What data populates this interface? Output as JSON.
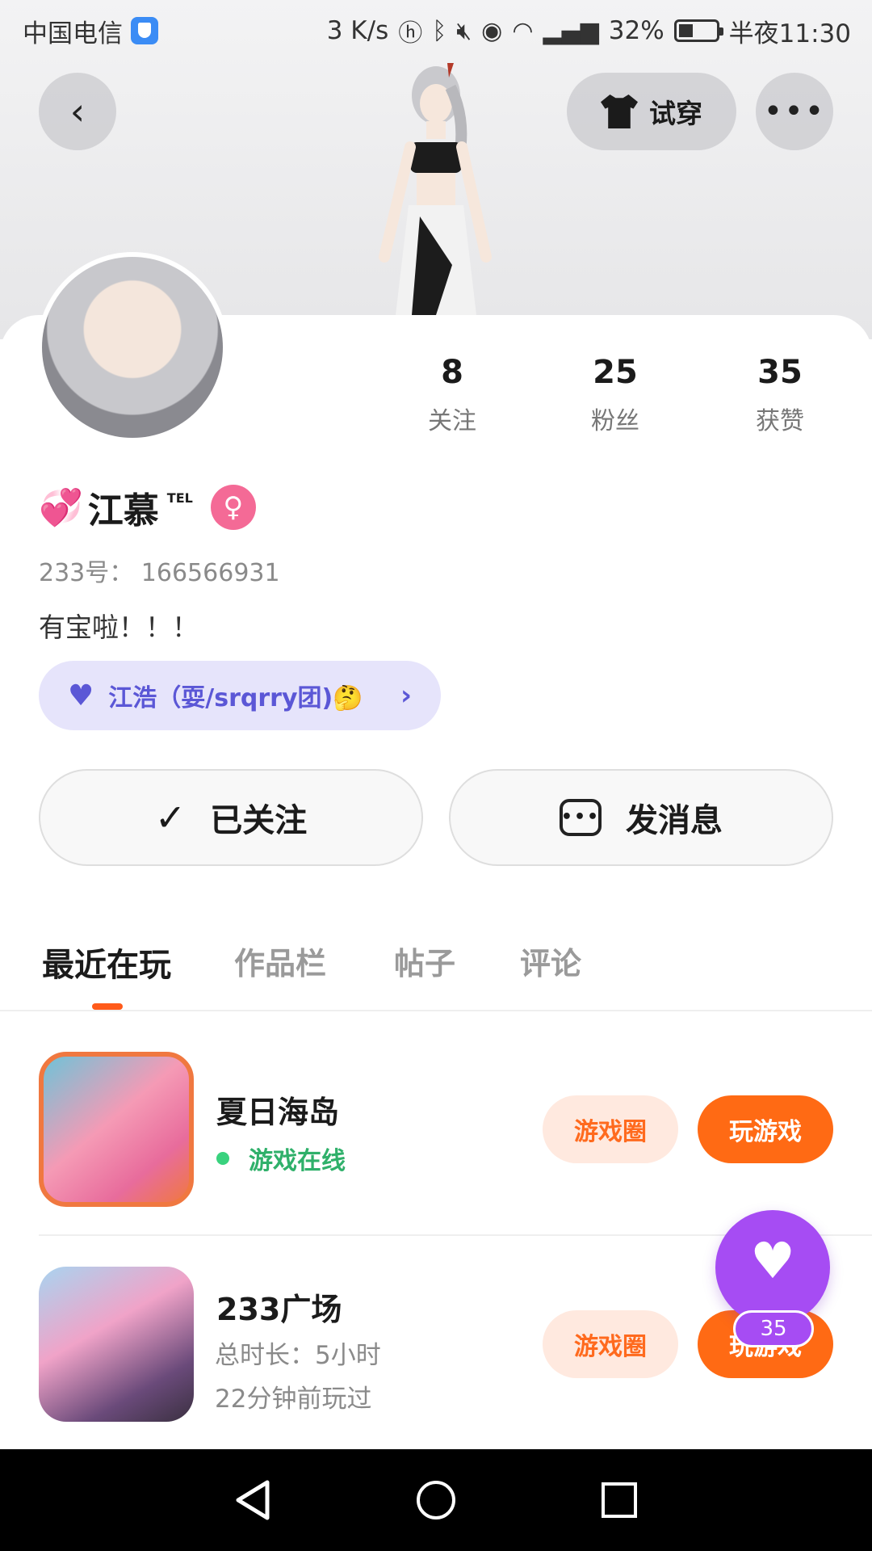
{
  "status_bar": {
    "carrier": "中国电信",
    "speed": "3 K/s",
    "battery": "32%",
    "time": "半夜11:30",
    "icons": [
      "hd-icon",
      "bluetooth-icon",
      "mute-icon",
      "eye-icon",
      "wifi-icon",
      "signal-icon",
      "battery-icon"
    ]
  },
  "header": {
    "back_icon": "chevron-left-icon",
    "try_on_label": "试穿",
    "try_on_icon": "shirt-icon",
    "more_icon": "more-dots-icon"
  },
  "stats": [
    {
      "value": "8",
      "label": "关注"
    },
    {
      "value": "25",
      "label": "粉丝"
    },
    {
      "value": "35",
      "label": "获赞"
    }
  ],
  "profile": {
    "name": "江慕",
    "name_suffix": "TEL",
    "gender": "female",
    "uid": "233号： 166566931",
    "bio": "有宝啦！！！",
    "cp_label": "江浩（耍/srqrry团)🤔"
  },
  "actions": {
    "follow_label": "已关注",
    "message_label": "发消息"
  },
  "tabs": [
    "最近在玩",
    "作品栏",
    "帖子",
    "评论"
  ],
  "active_tab": 0,
  "games": [
    {
      "title": "夏日海岛",
      "status": "游戏在线",
      "circle_label": "游戏圈",
      "play_label": "玩游戏"
    },
    {
      "title": "233广场",
      "meta1": "总时长：5小时",
      "meta2": "22分钟前玩过",
      "circle_label": "游戏圈",
      "play_label": "玩游戏"
    }
  ],
  "like_fab": {
    "count": "35"
  },
  "colors": {
    "accent": "#ff6a14",
    "purple": "#a64cf3",
    "online": "#2fb06a"
  }
}
